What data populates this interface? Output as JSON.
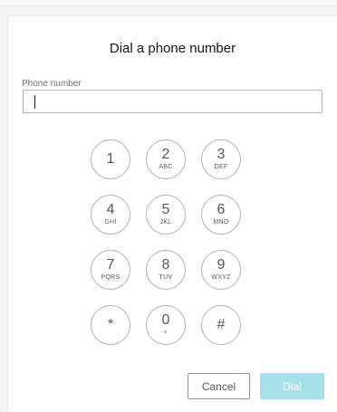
{
  "dialog": {
    "title": "Dial a phone number",
    "phone_label": "Phone number",
    "phone_value": "",
    "cancel_label": "Cancel",
    "dial_label": "Dial"
  },
  "keypad": [
    {
      "digit": "1",
      "letters": ""
    },
    {
      "digit": "2",
      "letters": "ABC"
    },
    {
      "digit": "3",
      "letters": "DEF"
    },
    {
      "digit": "4",
      "letters": "GHI"
    },
    {
      "digit": "5",
      "letters": "JKL"
    },
    {
      "digit": "6",
      "letters": "MNO"
    },
    {
      "digit": "7",
      "letters": "PQRS"
    },
    {
      "digit": "8",
      "letters": "TUV"
    },
    {
      "digit": "9",
      "letters": "WXYZ"
    },
    {
      "digit": "*",
      "letters": ""
    },
    {
      "digit": "0",
      "letters": "+"
    },
    {
      "digit": "#",
      "letters": ""
    }
  ],
  "colors": {
    "accent_disabled": "#a6e0e6",
    "text": "#16191f",
    "border": "#aab7b8"
  }
}
